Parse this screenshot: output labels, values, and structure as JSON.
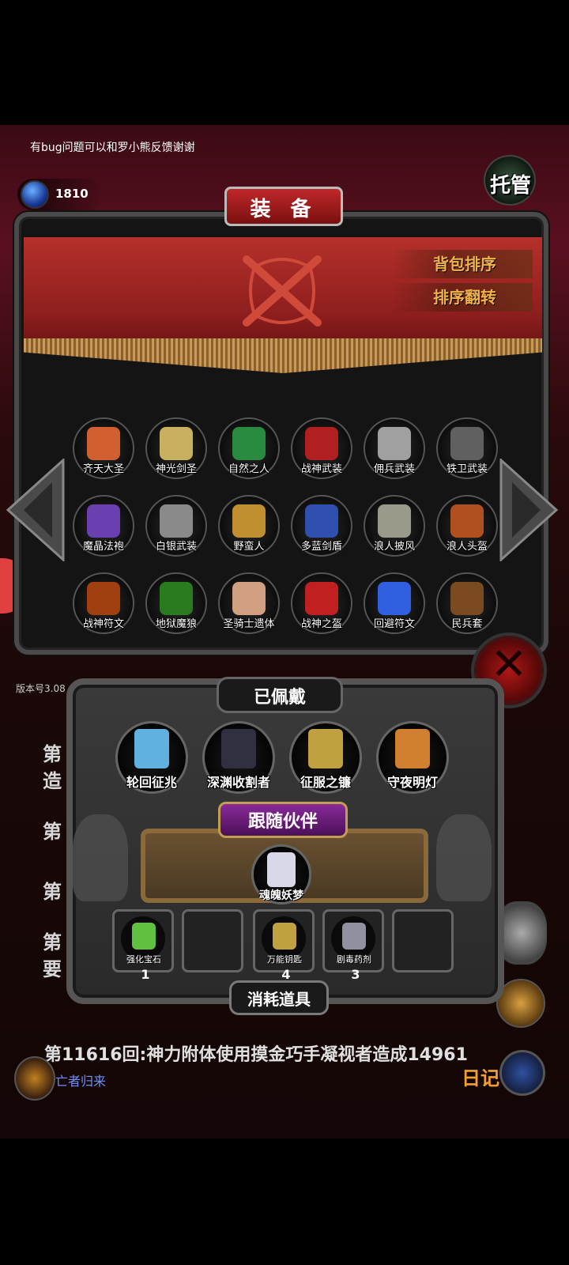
{
  "hud": {
    "notice": "有bug问题可以和罗小熊反馈谢谢",
    "gem_count": "1810",
    "auto_button": "托管",
    "version": "版本号3.08"
  },
  "equipment_panel": {
    "title": "装 备",
    "sort_button": "背包排序",
    "reverse_sort_button": "排序翻转",
    "items": [
      {
        "label": "齐天大圣",
        "color": "#d06030"
      },
      {
        "label": "神光剑圣",
        "color": "#c8b060"
      },
      {
        "label": "自然之人",
        "color": "#2a8a40"
      },
      {
        "label": "战神武装",
        "color": "#b02020"
      },
      {
        "label": "佣兵武装",
        "color": "#a0a0a0"
      },
      {
        "label": "铁卫武装",
        "color": "#606060"
      },
      {
        "label": "魔晶法袍",
        "color": "#6a40b0"
      },
      {
        "label": "白银武装",
        "color": "#8a8a8a"
      },
      {
        "label": "野蛮人",
        "color": "#c09030"
      },
      {
        "label": "多蓝剑盾",
        "color": "#3050b0"
      },
      {
        "label": "浪人披风",
        "color": "#9a9a8a"
      },
      {
        "label": "浪人头盔",
        "color": "#b05020"
      },
      {
        "label": "战神符文",
        "color": "#a04010"
      },
      {
        "label": "地狱魔狼",
        "color": "#2a7a20"
      },
      {
        "label": "圣骑士遗体",
        "color": "#d0a080"
      },
      {
        "label": "战神之盔",
        "color": "#c02020"
      },
      {
        "label": "回避符文",
        "color": "#3060e0"
      },
      {
        "label": "民兵套",
        "color": "#7a4a20"
      }
    ]
  },
  "worn": {
    "title": "已佩戴",
    "items": [
      {
        "label": "轮回征兆",
        "color": "#60b0e0"
      },
      {
        "label": "深渊收割者",
        "color": "#303040"
      },
      {
        "label": "征服之镰",
        "color": "#c0a040"
      },
      {
        "label": "守夜明灯",
        "color": "#d08030"
      }
    ]
  },
  "companion": {
    "title": "跟随伙伴",
    "name": "魂魄妖梦"
  },
  "consumables": {
    "title": "消耗道具",
    "slots": [
      {
        "label": "强化宝石",
        "count": "1",
        "color": "#60c040"
      },
      {
        "label": "",
        "count": "",
        "color": ""
      },
      {
        "label": "万能钥匙",
        "count": "4",
        "color": "#c0a040"
      },
      {
        "label": "剧毒药剂",
        "count": "3",
        "color": "#9090a0"
      },
      {
        "label": "",
        "count": "",
        "color": ""
      }
    ]
  },
  "log": {
    "prefix_lines": [
      "第",
      "造",
      "第",
      "第",
      "第",
      "要"
    ],
    "last_line": "第11616回:神力附体使用摸金巧手凝视者造成14961",
    "sub_line": "亡者归来",
    "diary_label": "日记"
  }
}
